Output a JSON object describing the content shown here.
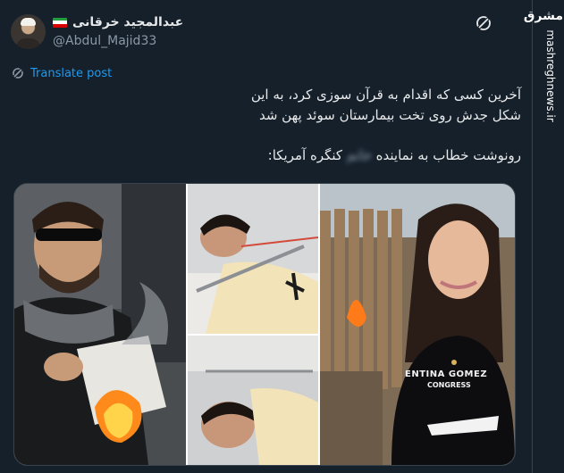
{
  "author": {
    "display_name": "عبدالمجید خرقانی",
    "handle": "@Abdul_Majid33",
    "flag_colors": [
      "#239f40",
      "#ffffff",
      "#da0000"
    ]
  },
  "menu_icon": "menu-icon",
  "translate": {
    "label": "Translate post",
    "icon": "translate-icon"
  },
  "post": {
    "line1": "آخرین کسی که اقدام به قرآن سوزی کرد، به این",
    "line2": "شکل جدش روی تخت بیمارستان سوئد پهن شد",
    "line3_before": "رونوشت خطاب به نماینده",
    "line3_blurred": "خانم",
    "line3_after": "کنگره آمریکا:"
  },
  "media": {
    "shirt_text_1": "ENTINA GOMEZ",
    "shirt_text_2": "CONGRESS",
    "panels": [
      "man-burning-book-photo",
      "man-in-hospital-bed-photo",
      "man-in-hospital-bed-photo-2",
      "woman-in-front-of-fire-photo"
    ]
  },
  "watermark": {
    "text": "mashreghnews.ir",
    "logo": "مشرق"
  },
  "colors": {
    "background": "#15202b",
    "link": "#1d9bf0",
    "muted": "#8b98a5",
    "divider": "#38444d"
  }
}
